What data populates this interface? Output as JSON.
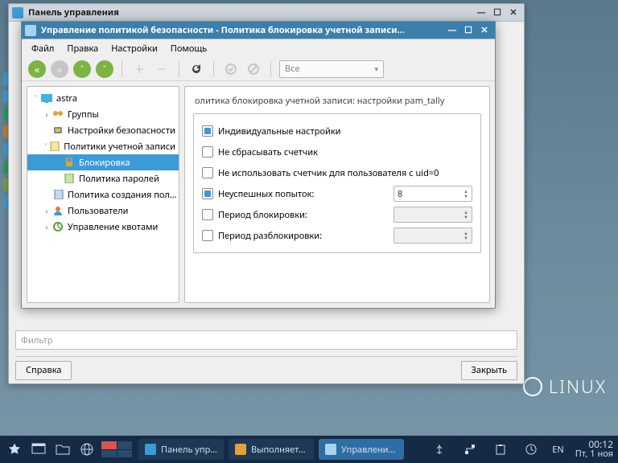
{
  "desktop": {
    "brand": "LINUX"
  },
  "parent_window": {
    "title": "Панель управления",
    "filter_placeholder": "Фильтр",
    "help_btn": "Справка",
    "close_btn": "Закрыть"
  },
  "child_window": {
    "title": "Управление политикой безопасности - Политика блокировка учетной записи…",
    "menu": {
      "file": "Файл",
      "edit": "Правка",
      "settings": "Настройки",
      "help": "Помощь"
    },
    "combo": "Все",
    "tree": {
      "root": "astra",
      "groups": "Группы",
      "security": "Настройки безопасности",
      "account_policies": "Политики учетной записи",
      "lockout": "Блокировка",
      "password": "Политика паролей",
      "creation": "Политика создания пол…",
      "users": "Пользователи",
      "quotas": "Управление квотами"
    },
    "detail": {
      "heading": "олитика блокировка учетной записи: настройки pam_tally",
      "individual": "Индивидуальные настройки",
      "no_reset": "Не сбрасывать счетчик",
      "no_root": "Не использовать счетчик для пользователя с uid=0",
      "fail_attempts_label": "Неуспешных попыток:",
      "fail_attempts_value": "8",
      "lock_period": "Период блокировки:",
      "unlock_period": "Период разблокировки:"
    }
  },
  "taskbar": {
    "task1": "Панель упр…",
    "task2": "Выполняет…",
    "task3": "Управлени…",
    "lang": "EN",
    "time": "00:12",
    "date": "Пт, 1 ноя"
  }
}
